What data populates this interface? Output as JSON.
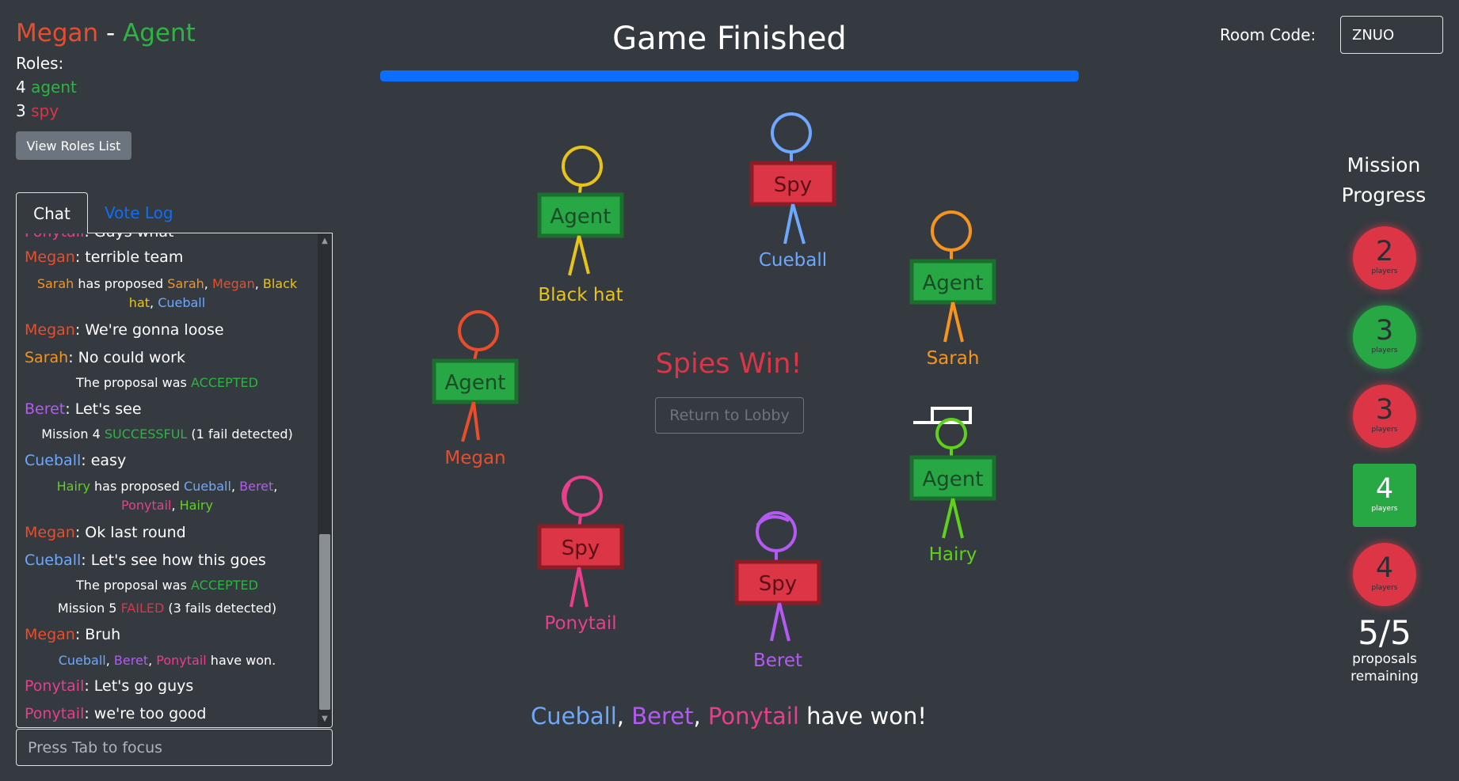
{
  "player": {
    "name": "Megan",
    "separator": "-",
    "role": "Agent"
  },
  "roles": {
    "label": "Roles:",
    "entries": [
      {
        "count": "4",
        "name": "agent"
      },
      {
        "count": "3",
        "name": "spy"
      }
    ],
    "view_button": "View Roles List"
  },
  "tabs": {
    "chat": "Chat",
    "vote_log": "Vote Log"
  },
  "chat": {
    "partial_top": {
      "name": "Ponytail",
      "text": ": Guys what"
    },
    "m1": {
      "name": "Megan",
      "text": ": terrible team"
    },
    "p1": {
      "proposer": "Sarah",
      "text": " has proposed ",
      "names": [
        "Sarah",
        "Megan",
        "Black",
        "hat",
        "Cueball"
      ],
      "comma": ", "
    },
    "m2": {
      "name": "Megan",
      "text": ": We're gonna loose"
    },
    "m3": {
      "name": "Sarah",
      "text": ": No could work"
    },
    "s1": {
      "text": "The proposal was ",
      "status": "ACCEPTED"
    },
    "m4": {
      "name": "Beret",
      "text": ": Let's see"
    },
    "s2": {
      "pre": "Mission 4 ",
      "status": "SUCCESSFUL",
      "post": " (1 fail detected)"
    },
    "m5": {
      "name": "Cueball",
      "text": ": easy"
    },
    "p2": {
      "proposer": "Hairy",
      "text": " has proposed ",
      "names": [
        "Cueball",
        "Beret",
        "Ponytail",
        "Hairy"
      ],
      "comma": ", "
    },
    "m6": {
      "name": "Megan",
      "text": ": Ok last round"
    },
    "m7": {
      "name": "Cueball",
      "text": ": Let's see how this goes"
    },
    "s3": {
      "text": "The proposal was ",
      "status": "ACCEPTED"
    },
    "s4": {
      "pre": "Mission 5 ",
      "status": "FAILED",
      "post": " (3 fails detected)"
    },
    "m8": {
      "name": "Megan",
      "text": ": Bruh"
    },
    "s5": {
      "names": [
        "Cueball",
        "Beret",
        "Ponytail"
      ],
      "comma": ", ",
      "text": " have won."
    },
    "m9": {
      "name": "Ponytail",
      "text": ": Let's go guys"
    },
    "m10": {
      "name": "Ponytail",
      "text": ": we're too good"
    },
    "input_placeholder": "Press Tab to focus"
  },
  "header": {
    "title": "Game Finished",
    "progress": 1.0
  },
  "room": {
    "label": "Room Code:",
    "code": "ZNUO"
  },
  "center": {
    "result": "Spies Win!",
    "lobby_button": "Return to Lobby"
  },
  "players": [
    {
      "name": "Black hat",
      "sign": "Agent",
      "color": "#e8c31a"
    },
    {
      "name": "Cueball",
      "sign": "Spy",
      "color": "#6ea8fe"
    },
    {
      "name": "Sarah",
      "sign": "Agent",
      "color": "#f7941d"
    },
    {
      "name": "Megan",
      "sign": "Agent",
      "color": "#ea4d2c"
    },
    {
      "name": "Hairy",
      "sign": "Agent",
      "color": "#5ed11d"
    },
    {
      "name": "Ponytail",
      "sign": "Spy",
      "color": "#e83e8c"
    },
    {
      "name": "Beret",
      "sign": "Spy",
      "color": "#b45af2"
    }
  ],
  "winners": {
    "names": [
      "Cueball",
      "Beret",
      "Ponytail"
    ],
    "comma": ", ",
    "text": " have won!"
  },
  "mission_progress": {
    "title_line1": "Mission",
    "title_line2": "Progress",
    "missions": [
      {
        "count": "2",
        "label": "players",
        "result": "fail"
      },
      {
        "count": "3",
        "label": "players",
        "result": "success"
      },
      {
        "count": "3",
        "label": "players",
        "result": "fail"
      },
      {
        "count": "4",
        "label": "players",
        "result": "current"
      },
      {
        "count": "4",
        "label": "players",
        "result": "fail"
      }
    ],
    "proposals": "5/5",
    "proposals_label_1": "proposals",
    "proposals_label_2": "remaining"
  }
}
